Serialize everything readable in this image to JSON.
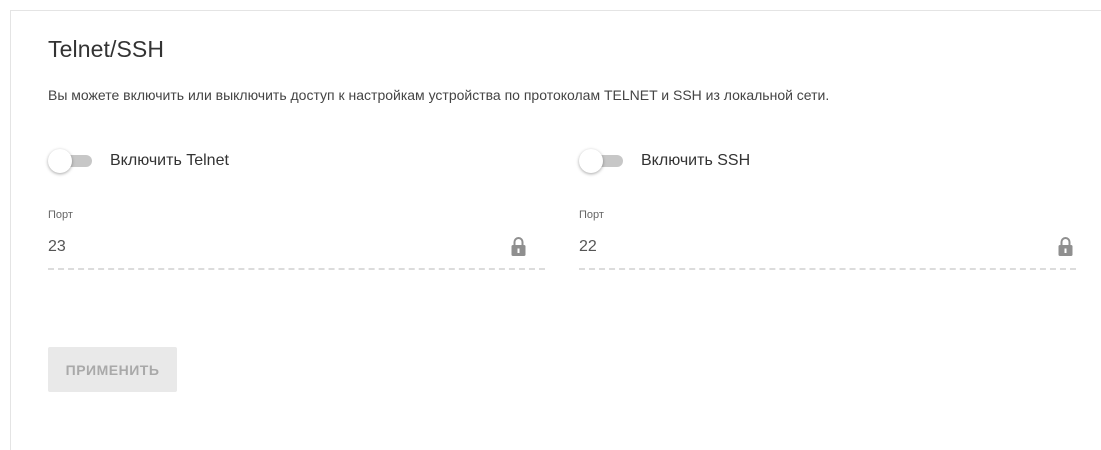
{
  "section": {
    "title": "Telnet/SSH",
    "description": "Вы можете включить или выключить доступ к настройкам устройства по протоколам TELNET и SSH из локальной сети."
  },
  "telnet": {
    "toggle_label": "Включить Telnet",
    "enabled": false,
    "port_label": "Порт",
    "port_value": "23"
  },
  "ssh": {
    "toggle_label": "Включить SSH",
    "enabled": false,
    "port_label": "Порт",
    "port_value": "22"
  },
  "actions": {
    "apply_label": "ПРИМЕНИТЬ"
  },
  "icons": {
    "lock": "lock-icon"
  },
  "colors": {
    "toggle_off_track": "#c7c7c7",
    "button_disabled_bg": "#e9e9e9",
    "button_disabled_text": "#a9a9a9"
  }
}
